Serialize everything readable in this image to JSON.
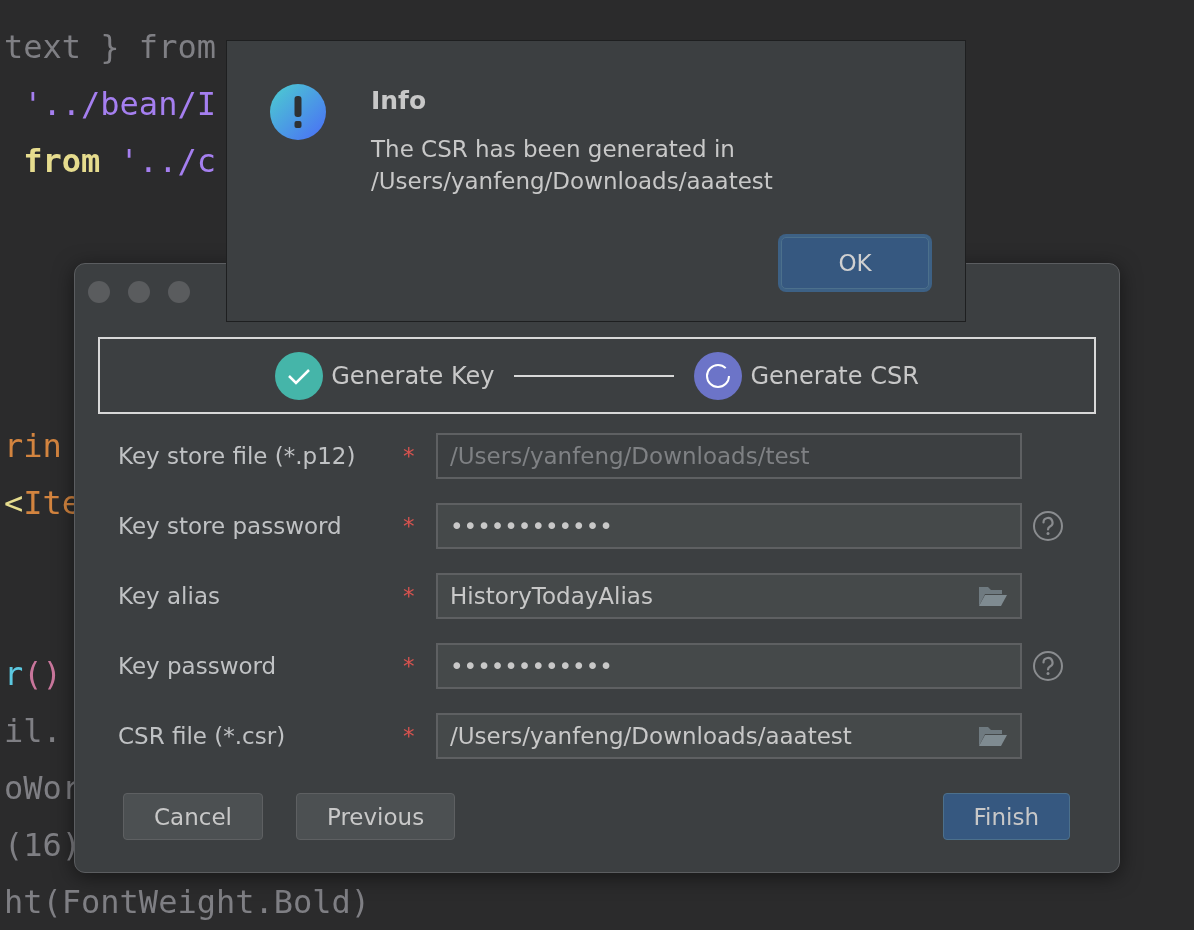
{
  "editor": {
    "lines": [
      {
        "segments": [
          {
            "text": "text } from",
            "color": "#7f7f84"
          }
        ]
      },
      {
        "segments": [
          {
            "text": " '../bean/I",
            "color": "#a57ff0"
          }
        ]
      },
      {
        "segments": [
          {
            "text": " from",
            "color": "#e6dc8e",
            "bold": true
          },
          {
            "text": " '../c",
            "color": "#a57ff0"
          }
        ]
      },
      {
        "segments": [
          {
            "text": "rin",
            "color": "#d3843f"
          }
        ]
      },
      {
        "segments": [
          {
            "text": "<",
            "color": "#e6dc8e"
          },
          {
            "text": "Ite",
            "color": "#d3843f"
          }
        ]
      },
      {
        "segments": [
          {
            "text": "r",
            "color": "#5cc8e0"
          },
          {
            "text": "()",
            "color": "#c9769c"
          }
        ]
      },
      {
        "segments": [
          {
            "text": "il.",
            "color": "#7f7f84"
          }
        ]
      },
      {
        "segments": [
          {
            "text": "oWor",
            "color": "#7f7f84"
          }
        ]
      },
      {
        "segments": [
          {
            "text": "(16)",
            "color": "#7f7f84"
          }
        ]
      },
      {
        "segments": [
          {
            "text": "ht(FontWeight.Bold)",
            "color": "#7f7f84"
          }
        ]
      }
    ]
  },
  "wizard": {
    "steps": [
      {
        "label": "Generate Key",
        "completed": true
      },
      {
        "label": "Generate CSR",
        "completed": false
      }
    ],
    "fields": [
      {
        "label": "Key store file (*.p12)",
        "required_mark": "*",
        "value": "/Users/yanfeng/Downloads/test",
        "disabled": true,
        "kind": "plain"
      },
      {
        "label": "Key store password",
        "required_mark": "*",
        "value": "••••••••••••",
        "disabled": false,
        "kind": "help"
      },
      {
        "label": "Key alias",
        "required_mark": "*",
        "value": "HistoryTodayAlias",
        "disabled": false,
        "kind": "browse"
      },
      {
        "label": "Key password",
        "required_mark": "*",
        "value": "••••••••••••",
        "disabled": false,
        "kind": "help"
      },
      {
        "label": "CSR file (*.csr)",
        "required_mark": "*",
        "value": "/Users/yanfeng/Downloads/aaatest",
        "disabled": false,
        "kind": "browse"
      }
    ],
    "buttons": [
      {
        "label": "Cancel",
        "primary": false
      },
      {
        "label": "Previous",
        "primary": false
      },
      {
        "label": "Finish",
        "primary": true
      }
    ]
  },
  "info_dialog": {
    "title": "Info",
    "message_lines": [
      "The CSR has been generated in",
      "/Users/yanfeng/Downloads/aaatest"
    ],
    "button": {
      "label": "OK",
      "focused": true
    }
  }
}
